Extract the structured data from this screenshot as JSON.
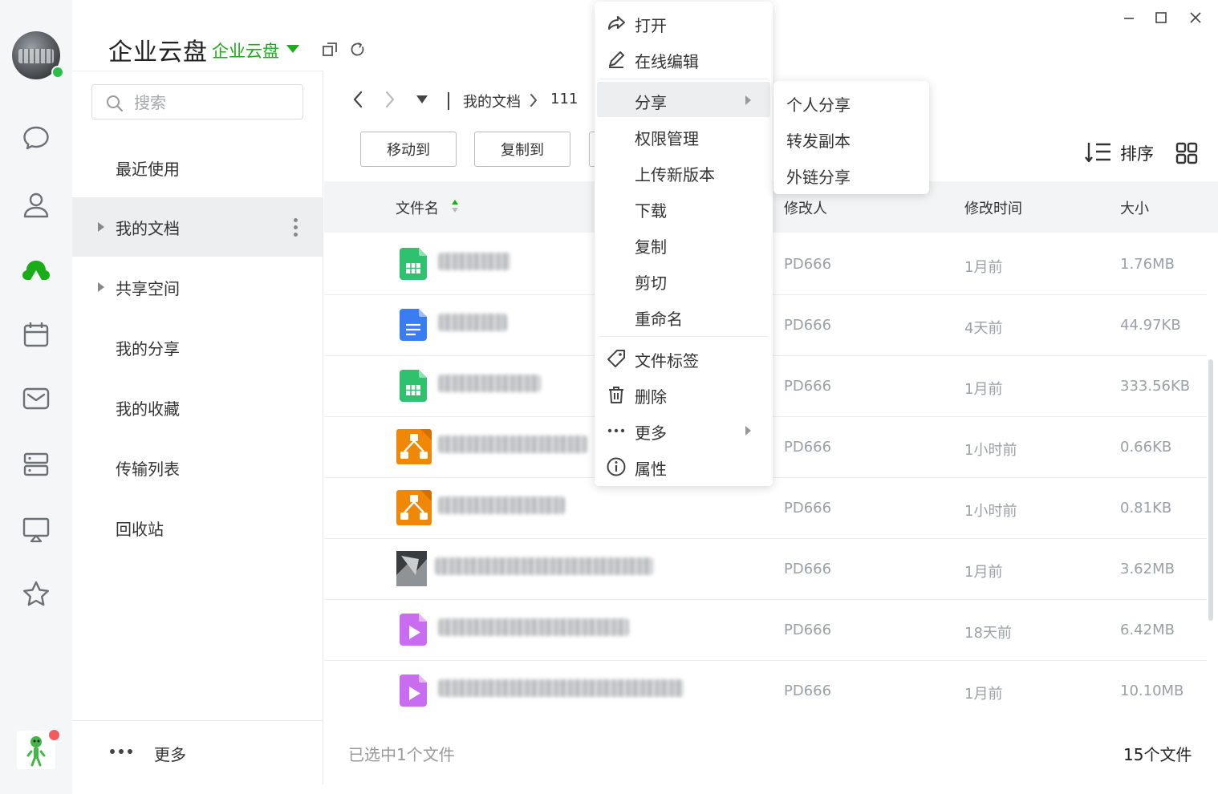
{
  "app": {
    "title": "企业云盘",
    "subtitle": "企业云盘"
  },
  "search": {
    "placeholder": "搜索"
  },
  "sidebar": {
    "items": [
      {
        "label": "最近使用"
      },
      {
        "label": "我的文档"
      },
      {
        "label": "共享空间"
      },
      {
        "label": "我的分享"
      },
      {
        "label": "我的收藏"
      },
      {
        "label": "传输列表"
      },
      {
        "label": "回收站"
      }
    ],
    "more_label": "更多"
  },
  "breadcrumb": {
    "part1": "我的文档",
    "part2": "111"
  },
  "toolbar": {
    "move_label": "移动到",
    "copy_label": "复制到",
    "sort_label": "排序"
  },
  "table": {
    "headers": {
      "name": "文件名",
      "modifier": "修改人",
      "time": "修改时间",
      "size": "大小"
    },
    "rows": [
      {
        "icon": "spreadsheet-icon",
        "modifier": "PD666",
        "time": "1月前",
        "size": "1.76MB"
      },
      {
        "icon": "document-icon",
        "modifier": "PD666",
        "time": "4天前",
        "size": "44.97KB"
      },
      {
        "icon": "spreadsheet-icon",
        "modifier": "PD666",
        "time": "1月前",
        "size": "333.56KB"
      },
      {
        "icon": "drawio-icon",
        "modifier": "PD666",
        "time": "1小时前",
        "size": "0.66KB"
      },
      {
        "icon": "drawio-icon",
        "modifier": "PD666",
        "time": "1小时前",
        "size": "0.81KB"
      },
      {
        "icon": "image-icon",
        "modifier": "PD666",
        "time": "1月前",
        "size": "3.62MB"
      },
      {
        "icon": "video-icon",
        "modifier": "PD666",
        "time": "18天前",
        "size": "6.42MB"
      },
      {
        "icon": "video-icon",
        "modifier": "PD666",
        "time": "1月前",
        "size": "10.10MB"
      }
    ]
  },
  "footer": {
    "selected": "已选中1个文件",
    "count": "15个文件"
  },
  "context_menu": {
    "open": "打开",
    "edit_online": "在线编辑",
    "share": "分享",
    "permissions": "权限管理",
    "upload_version": "上传新版本",
    "download": "下载",
    "copy": "复制",
    "cut": "剪切",
    "rename": "重命名",
    "tags": "文件标签",
    "delete": "删除",
    "more": "更多",
    "properties": "属性"
  },
  "share_submenu": {
    "personal": "个人分享",
    "forward": "转发副本",
    "external": "外链分享"
  },
  "colors": {
    "accent": "#1aad19",
    "online": "#2dbd4b",
    "badge": "#f15b5b"
  }
}
